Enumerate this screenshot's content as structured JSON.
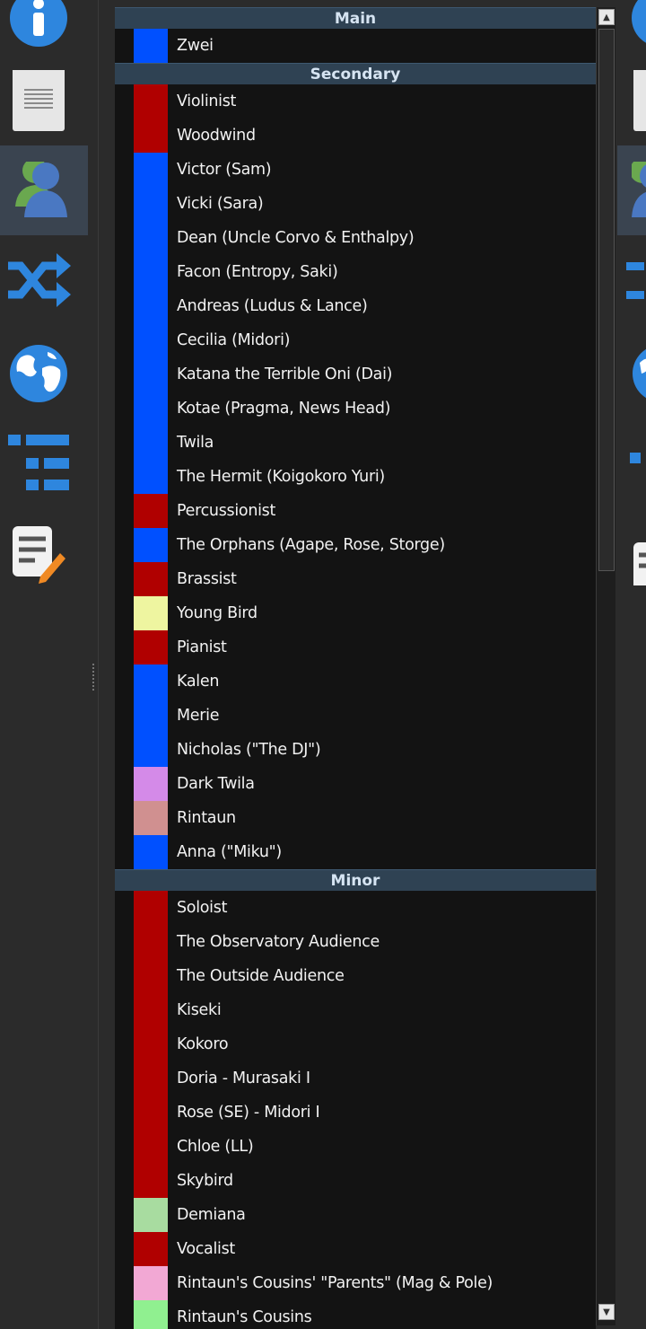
{
  "toolbar": {
    "items": [
      {
        "name": "info-icon"
      },
      {
        "name": "document-icon"
      },
      {
        "name": "character-icon",
        "active": true
      },
      {
        "name": "shuffle-icon"
      },
      {
        "name": "globe-icon"
      },
      {
        "name": "list-icon"
      },
      {
        "name": "notes-edit-icon"
      }
    ]
  },
  "colors": {
    "red": "#b00000",
    "blue": "#0050ff",
    "yellow": "#eef5a0",
    "violet": "#d48ae8",
    "rose": "#d09090",
    "green": "#a8dca0",
    "pink": "#f2a8d4",
    "lime": "#90f090"
  },
  "groups": [
    {
      "title": "Main",
      "items": [
        {
          "label": "Zwei",
          "color": "#0050ff"
        }
      ]
    },
    {
      "title": "Secondary",
      "items": [
        {
          "label": "Violinist",
          "color": "#b00000"
        },
        {
          "label": "Woodwind",
          "color": "#b00000"
        },
        {
          "label": "Victor (Sam)",
          "color": "#0050ff"
        },
        {
          "label": "Vicki (Sara)",
          "color": "#0050ff"
        },
        {
          "label": "Dean (Uncle Corvo & Enthalpy)",
          "color": "#0050ff"
        },
        {
          "label": "Facon (Entropy, Saki)",
          "color": "#0050ff"
        },
        {
          "label": "Andreas (Ludus & Lance)",
          "color": "#0050ff"
        },
        {
          "label": "Cecilia (Midori)",
          "color": "#0050ff"
        },
        {
          "label": "Katana the Terrible Oni (Dai)",
          "color": "#0050ff"
        },
        {
          "label": "Kotae (Pragma, News Head)",
          "color": "#0050ff"
        },
        {
          "label": "Twila",
          "color": "#0050ff"
        },
        {
          "label": "The Hermit (Koigokoro Yuri)",
          "color": "#0050ff"
        },
        {
          "label": "Percussionist",
          "color": "#b00000"
        },
        {
          "label": "The Orphans (Agape, Rose, Storge)",
          "color": "#0050ff"
        },
        {
          "label": "Brassist",
          "color": "#b00000"
        },
        {
          "label": "Young Bird",
          "color": "#eef5a0"
        },
        {
          "label": "Pianist",
          "color": "#b00000"
        },
        {
          "label": "Kalen",
          "color": "#0050ff"
        },
        {
          "label": "Merie",
          "color": "#0050ff"
        },
        {
          "label": "Nicholas (\"The DJ\")",
          "color": "#0050ff"
        },
        {
          "label": "Dark Twila",
          "color": "#d48ae8"
        },
        {
          "label": "Rintaun",
          "color": "#d09090"
        },
        {
          "label": "Anna (\"Miku\")",
          "color": "#0050ff"
        }
      ]
    },
    {
      "title": "Minor",
      "items": [
        {
          "label": "Soloist",
          "color": "#b00000"
        },
        {
          "label": "The Observatory Audience",
          "color": "#b00000"
        },
        {
          "label": "The Outside Audience",
          "color": "#b00000"
        },
        {
          "label": "Kiseki",
          "color": "#b00000"
        },
        {
          "label": "Kokoro",
          "color": "#b00000"
        },
        {
          "label": "Doria - Murasaki I",
          "color": "#b00000"
        },
        {
          "label": "Rose (SE) - Midori I",
          "color": "#b00000"
        },
        {
          "label": "Chloe (LL)",
          "color": "#b00000"
        },
        {
          "label": "Skybird",
          "color": "#b00000"
        },
        {
          "label": "Demiana",
          "color": "#a8dca0"
        },
        {
          "label": "Vocalist",
          "color": "#b00000"
        },
        {
          "label": "Rintaun's Cousins' \"Parents\" (Mag & Pole)",
          "color": "#f2a8d4"
        },
        {
          "label": "Rintaun's Cousins",
          "color": "#90f090"
        }
      ]
    }
  ],
  "scrollbar": {
    "up": "▲",
    "down": "▼"
  }
}
